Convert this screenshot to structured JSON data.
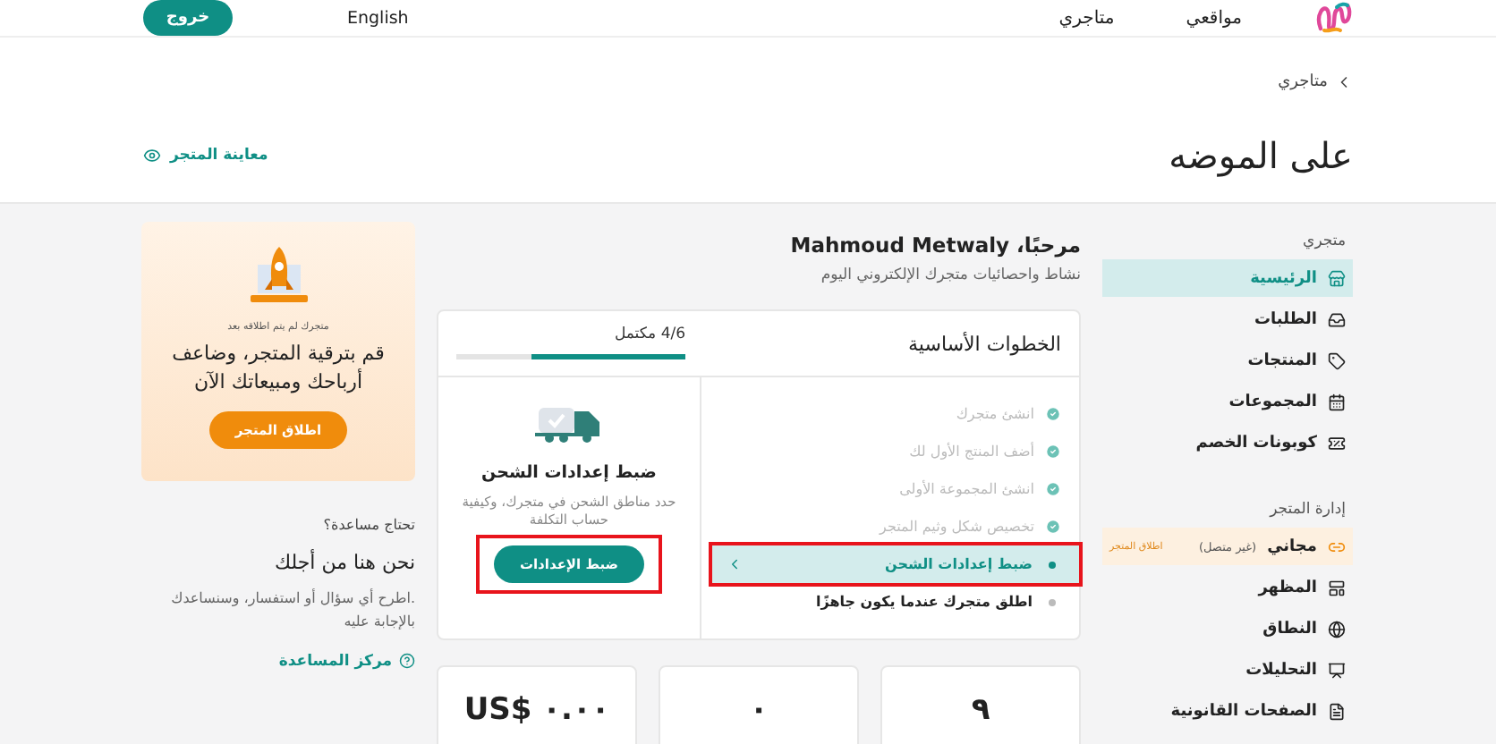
{
  "header": {
    "nav": [
      {
        "label": "مواقعي"
      },
      {
        "label": "متاجري"
      }
    ],
    "language": "English",
    "logout": "خروج"
  },
  "page": {
    "breadcrumb": "متاجري",
    "title": "على الموضه",
    "preview_link": "معاينة المتجر"
  },
  "sidebar": {
    "sections": [
      {
        "title": "متجري",
        "items": [
          {
            "kind": "link",
            "label": "الرئيسية",
            "selected": true
          },
          {
            "kind": "link",
            "label": "الطلبات",
            "selected": false
          },
          {
            "kind": "link",
            "label": "المنتجات",
            "selected": false
          },
          {
            "kind": "link",
            "label": "المجموعات",
            "selected": false
          },
          {
            "kind": "link",
            "label": "كوبونات الخصم",
            "selected": false
          }
        ]
      },
      {
        "title": "إدارة المتجر",
        "items": [
          {
            "kind": "plan",
            "label": "مجاني",
            "note": "(غير متصل)",
            "badge": "اطلاق المتجر",
            "selected": false
          },
          {
            "kind": "link",
            "label": "المظهر",
            "selected": false
          },
          {
            "kind": "link",
            "label": "النطاق",
            "selected": false
          },
          {
            "kind": "link",
            "label": "التحليلات",
            "selected": false
          },
          {
            "kind": "link",
            "label": "الصفحات القانونية",
            "selected": false
          }
        ]
      }
    ]
  },
  "welcome": {
    "greeting": "مرحبًا، Mahmoud Metwaly",
    "subtitle": "نشاط واحصائيات متجرك الإلكتروني اليوم"
  },
  "steps_card": {
    "title": "الخطوات الأساسية",
    "progress": {
      "label": "4/6 مكتمل",
      "level": 0.67
    },
    "steps": [
      {
        "label": "انشئ متجرك",
        "done": true,
        "selected": false,
        "annotated": false
      },
      {
        "label": "أضف المنتج الأول لك",
        "done": true,
        "selected": false,
        "annotated": false
      },
      {
        "label": "انشئ المجموعة الأولى",
        "done": true,
        "selected": false,
        "annotated": false
      },
      {
        "label": "تخصيص شكل وثيم المتجر",
        "done": true,
        "selected": false,
        "annotated": false
      },
      {
        "label": "ضبط إعدادات الشحن",
        "done": false,
        "selected": true,
        "annotated": true
      },
      {
        "label": "اطلق متجرك عندما يكون جاهزًا",
        "done": false,
        "selected": false,
        "annotated": false
      }
    ],
    "detail": {
      "title": "ضبط إعدادات الشحن",
      "description": "حدد مناطق الشحن في متجرك، وكيفية حساب التكلفة",
      "button": "ضبط الإعدادات",
      "annotated": true
    }
  },
  "stats": [
    {
      "value": "٩"
    },
    {
      "value": "٠"
    },
    {
      "value": "US$ ٠.٠٠"
    }
  ],
  "promo": {
    "note": "متجرك لم يتم اطلاقه بعد",
    "headline": "قم بترقية المتجر، وضاعف أرباحك ومبيعاتك الآن",
    "button": "اطلاق المتجر"
  },
  "help": {
    "kicker": "تحتاج مساعدة؟",
    "title": "نحن هنا من أجلك",
    "body": ".اطرح أي سؤال أو استفسار، وسنساعدك بالإجابة عليه",
    "link": "مركز المساعدة"
  }
}
